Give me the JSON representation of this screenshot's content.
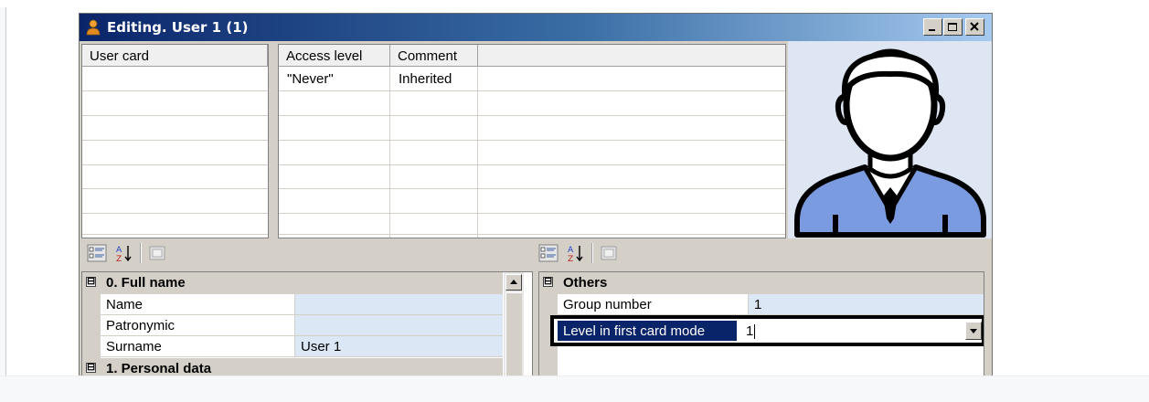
{
  "window": {
    "title": "Editing. User 1 (1)",
    "controls": [
      "minimize-icon",
      "maximize-icon",
      "close-icon"
    ]
  },
  "user_card_grid": {
    "header": "User card",
    "rows": [
      "",
      "",
      "",
      "",
      "",
      "",
      ""
    ]
  },
  "access_grid": {
    "headers": [
      "Access level",
      "Comment",
      ""
    ],
    "rows": [
      {
        "access_level": "\"Never\"",
        "comment": "Inherited"
      }
    ]
  },
  "left_properties": {
    "toolbar_icons": [
      "categorized-icon",
      "alphabetical-sort-icon",
      "property-pages-icon"
    ],
    "category": "0. Full name",
    "category_expander": "⊟",
    "rows": [
      {
        "label": "Name",
        "value": ""
      },
      {
        "label": "Patronymic",
        "value": ""
      },
      {
        "label": "Surname",
        "value": "User 1"
      }
    ],
    "next_category": "1. Personal data"
  },
  "right_properties": {
    "toolbar_icons": [
      "categorized-icon",
      "alphabetical-sort-icon",
      "property-pages-icon"
    ],
    "category": "Others",
    "category_expander": "⊟",
    "rows": [
      {
        "label": "Group number",
        "value": "1"
      },
      {
        "label": "Level in first card mode",
        "value": "1"
      }
    ]
  },
  "colors": {
    "title_gradient_start": "#0a246a",
    "title_gradient_end": "#a6caf0",
    "avatar_body": "#7b9be0",
    "selection": "#0a246a",
    "value_background": "#dbe7f5"
  }
}
